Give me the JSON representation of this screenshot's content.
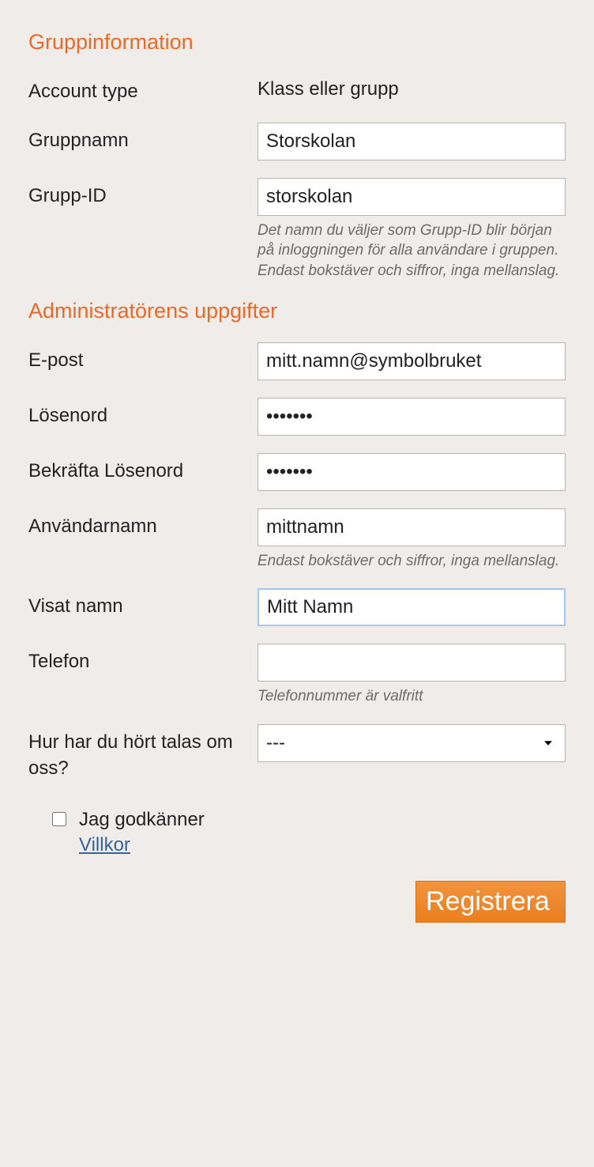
{
  "section_group": {
    "heading": "Gruppinformation",
    "account_type_label": "Account type",
    "account_type_value": "Klass eller grupp",
    "group_name_label": "Gruppnamn",
    "group_name_value": "Storskolan",
    "group_id_label": "Grupp-ID",
    "group_id_value": "storskolan",
    "group_id_help": "Det namn du väljer som Grupp-ID blir början på inloggningen för alla användare i gruppen. Endast bokstäver och siffror, inga mellanslag."
  },
  "section_admin": {
    "heading": "Administratörens uppgifter",
    "email_label": "E-post",
    "email_value": "mitt.namn@symbolbruket",
    "password_label": "Lösenord",
    "password_value": "hemligt",
    "confirm_label": "Bekräfta Lösenord",
    "confirm_value": "hemligt",
    "username_label": "Användarnamn",
    "username_value": "mittnamn",
    "username_help": "Endast bokstäver och siffror, inga mellanslag.",
    "display_label": "Visat namn",
    "display_value": "Mitt Namn",
    "phone_label": "Telefon",
    "phone_value": "",
    "phone_help": "Telefonnummer är valfritt",
    "heard_label": "Hur har du hört talas om oss?",
    "heard_value": "---"
  },
  "terms": {
    "accept_text": "Jag godkänner",
    "link_text": "Villkor"
  },
  "submit_label": "Registrera"
}
